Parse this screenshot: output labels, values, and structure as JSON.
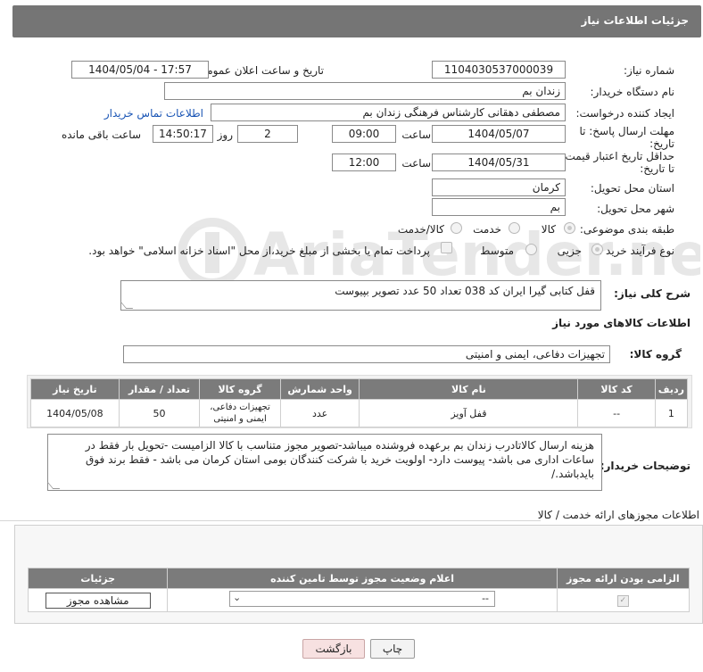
{
  "header": {
    "title": "جزئیات اطلاعات نیاز"
  },
  "form": {
    "need_number_label": "شماره نیاز:",
    "need_number": "1104030537000039",
    "announce_label": "تاریخ و ساعت اعلان عمومی:",
    "announce_value": "1404/05/04 - 17:57",
    "buyer_org_label": "نام دستگاه خریدار:",
    "buyer_org": "زندان بم",
    "creator_label": "ایجاد کننده درخواست:",
    "creator": "مصطفی دهقانی کارشناس فرهنگی زندان بم",
    "contact_link": "اطلاعات تماس خریدار",
    "deadline_label_1": "مهلت ارسال پاسخ: تا",
    "deadline_label_2": "تاریخ:",
    "deadline_date": "1404/05/07",
    "time_label": "ساعت",
    "deadline_time": "09:00",
    "days_value": "2",
    "days_label": "روز و",
    "remaining_time": "14:50:17",
    "remaining_label": "ساعت باقی مانده",
    "validity_label_1": "حداقل تاریخ اعتبار قیمت:",
    "validity_label_2": "تا تاریخ:",
    "validity_date": "1404/05/31",
    "validity_time": "12:00",
    "province_label": "استان محل تحویل:",
    "province": "کرمان",
    "city_label": "شهر محل تحویل:",
    "city": "بم",
    "category_label": "طبقه بندی موضوعی:",
    "category_options": [
      "کالا",
      "خدمت",
      "کالا/خدمت"
    ],
    "process_label": "نوع فرآیند خرید :",
    "process_options": [
      "جزیی",
      "متوسط"
    ],
    "payment_text": "پرداخت تمام یا بخشی از مبلغ خرید،از محل \"اسناد خزانه اسلامی\" خواهد بود."
  },
  "description": {
    "label": "شرح کلی نیاز:",
    "text": "قفل کتابی گیرا ایران کد 038 تعداد 50 عدد تصویر بپیوست"
  },
  "goods": {
    "section_title": "اطلاعات کالاهای مورد نیاز",
    "group_label": "گروه کالا:",
    "group_value": "تجهیزات دفاعی، ایمنی و امنیتی",
    "columns": [
      "ردیف",
      "کد کالا",
      "نام کالا",
      "واحد شمارش",
      "گروه کالا",
      "تعداد / مقدار",
      "تاریخ نیاز"
    ],
    "rows": [
      {
        "row": "1",
        "code": "--",
        "name": "قفل آویز",
        "unit": "عدد",
        "group": "تجهیزات دفاعی، ایمنی و امنیتی",
        "qty": "50",
        "date": "1404/05/08"
      }
    ]
  },
  "buyer_notes": {
    "label": "توضیحات خریدار:",
    "text": "هزینه ارسال کالاتادرب زندان بم برعهده فروشنده میباشد-تصویر مجوز متناسب با کالا الزامیست -تحویل بار فقط در ساعات اداری می باشد- پیوست دارد- اولویت خرید با شرکت کنندگان بومی استان کرمان می باشد - فقط برند فوق بایدباشد./"
  },
  "permits": {
    "section_title": "اطلاعات مجوزهای ارائه خدمت / کالا",
    "columns": [
      "الزامی بودن ارائه مجوز",
      "اعلام وضعیت مجوز توسط تامین کننده",
      "جزئیات"
    ],
    "select_value": "--",
    "view_button": "مشاهده مجوز"
  },
  "footer": {
    "print_button": "چاپ",
    "back_button": "بازگشت"
  },
  "watermark": {
    "text": "AriaTender.net"
  }
}
